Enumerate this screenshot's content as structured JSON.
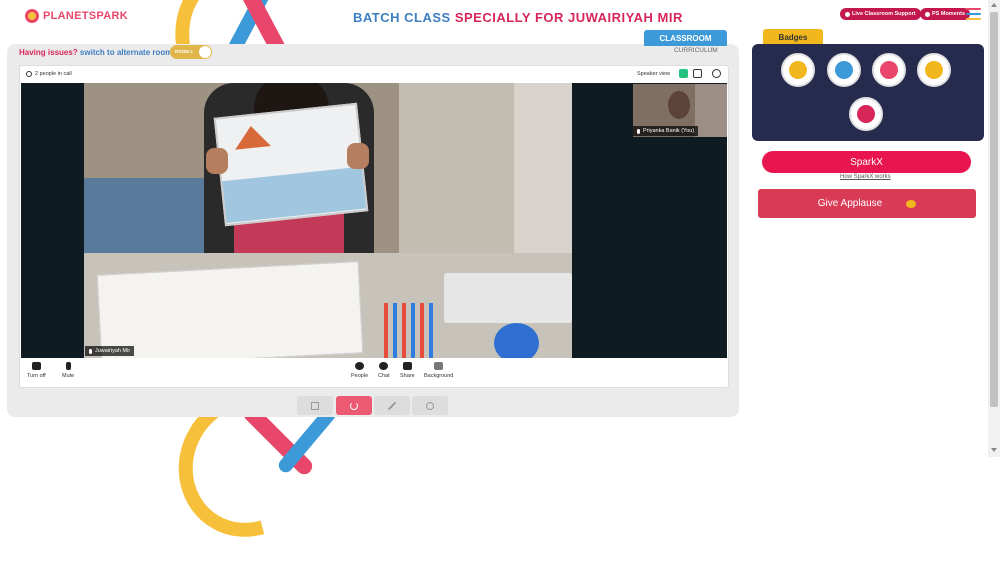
{
  "header": {
    "logo": "PLANETSPARK",
    "title_part1": "BATCH CLASS ",
    "title_part2": "SPECIALLY FOR JUWAIRIYAH MIR",
    "support_button": "Live Classroom Support",
    "moments_button": "PS Moments",
    "menu_colors": [
      "#e8466a",
      "#3d9ad8",
      "#f7c03a"
    ]
  },
  "tabs": {
    "classroom": "CLASSROOM",
    "curriculum": "CURRICULUM"
  },
  "room": {
    "issue_text": "Having issues?",
    "switch_text": "switch to alternate room",
    "toggle_label": "ROOM 2"
  },
  "call": {
    "people_count": "2 people in call",
    "speaker_view": "Speaker view",
    "main_participant": "Juwairiyah Mir",
    "self_participant": "Priyanka Banik (You)"
  },
  "controls": {
    "turn_off": "Turn off",
    "mute": "Mute",
    "people": "People",
    "chat": "Chat",
    "share": "Share",
    "background": "Background"
  },
  "badges": {
    "title": "Badges",
    "colors": [
      "#f2b71d",
      "#3d9ad8",
      "#e8466a",
      "#f2b71d",
      "#d6265a"
    ]
  },
  "sparkx": {
    "label": "SparkX",
    "link": "How SparkX works"
  },
  "applause": {
    "label": "Give Applause"
  }
}
